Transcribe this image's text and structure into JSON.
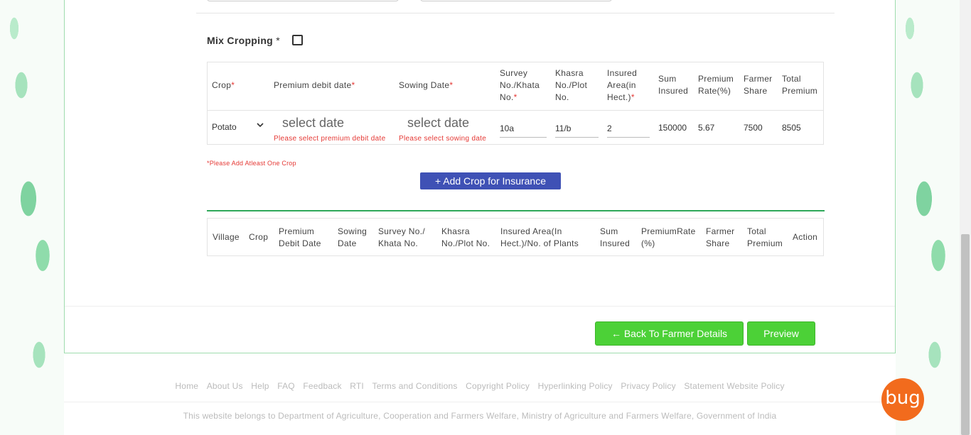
{
  "mix_cropping": {
    "label": "Mix Cropping",
    "required": "*"
  },
  "crop_table": {
    "headers": {
      "crop": "Crop",
      "premium_debit_date": "Premium debit date",
      "sowing_date": "Sowing Date",
      "survey_l1": "Survey",
      "survey_l2": "No./Khata",
      "survey_l3": "No.",
      "khasra_l1": "Khasra",
      "khasra_l2": "No./Plot",
      "khasra_l3": "No.",
      "insured_l1": "Insured",
      "insured_l2": "Area(in",
      "insured_l3": "Hect.)",
      "sum_l1": "Sum",
      "sum_l2": "Insured",
      "rate_l1": "Premium",
      "rate_l2": "Rate(%)",
      "farmer_l1": "Farmer",
      "farmer_l2": "Share",
      "total_l1": "Total",
      "total_l2": "Premium",
      "star": "*"
    },
    "row": {
      "crop": "Potato",
      "premium_date_placeholder": "select date",
      "premium_date_error": "Please select premium debit date",
      "sowing_date_placeholder": "select date",
      "sowing_date_error": "Please select sowing date",
      "survey": "10a",
      "khasra": "11/b",
      "insured_area": "2",
      "sum_insured": "150000",
      "premium_rate": "5.67",
      "farmer_share": "7500",
      "total_premium": "8505"
    }
  },
  "add_crop": {
    "error": "*Please Add Atleast One Crop",
    "button": "+ Add Crop for Insurance"
  },
  "summary_table": {
    "village": "Village",
    "crop": "Crop",
    "premium_l1": "Premium",
    "premium_l2": "Debit Date",
    "sowing_l1": "Sowing",
    "sowing_l2": "Date",
    "survey_l1": "Survey No./",
    "survey_l2": "Khata No.",
    "khasra_l1": "Khasra",
    "khasra_l2": "No./Plot No.",
    "insured_l1": "Insured Area(In",
    "insured_l2": "Hect.)/No. of Plants",
    "sum_l1": "Sum",
    "sum_l2": "Insured",
    "rate_l1": "PremiumRate",
    "rate_l2": "(%)",
    "farmer_l1": "Farmer",
    "farmer_l2": "Share",
    "total_l1": "Total",
    "total_l2": "Premium",
    "action": "Action"
  },
  "buttons": {
    "back": "← Back To Farmer Details",
    "preview": "Preview"
  },
  "footer": {
    "links": [
      "Home",
      "About Us",
      "Help",
      "FAQ",
      "Feedback",
      "RTI",
      "Terms and Conditions",
      "Copyright Policy",
      "Hyperlinking Policy",
      "Privacy Policy",
      "Statement Website Policy"
    ],
    "copyright": "This website belongs to Department of Agriculture, Cooperation and Farmers Welfare, Ministry of Agriculture and Farmers Welfare, Government of India"
  },
  "bug_widget": {
    "label": "bug"
  },
  "colors": {
    "primary": "#3f51b5",
    "success": "#4cd137",
    "error": "#e53935",
    "divider": "#2fa85a"
  }
}
